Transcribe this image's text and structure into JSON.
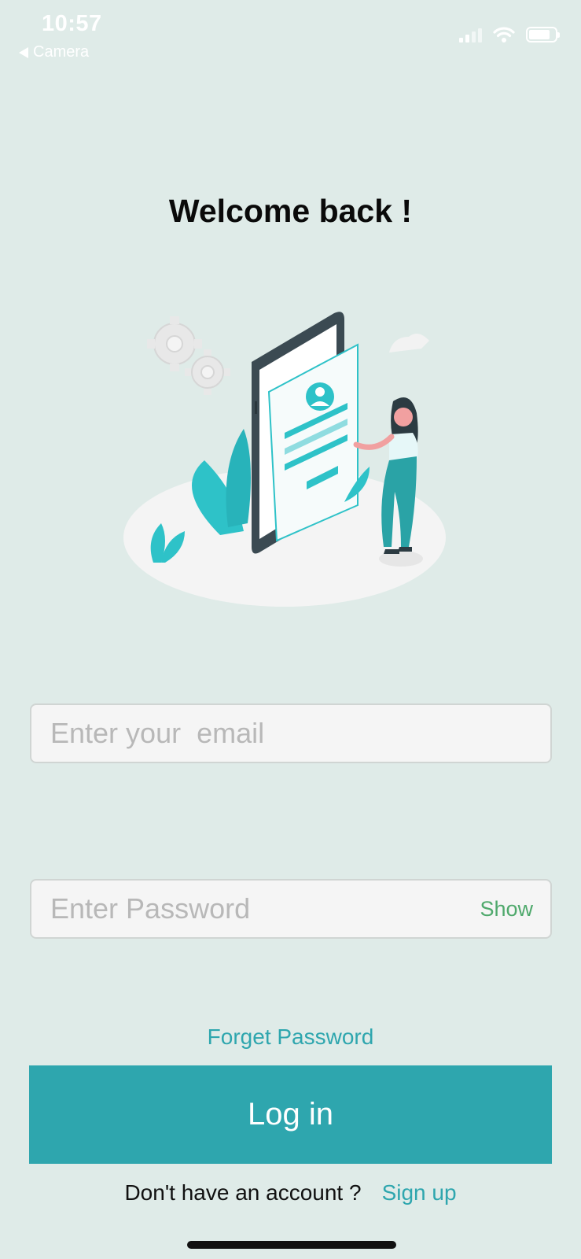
{
  "status_bar": {
    "time": "10:57",
    "back_label": "Camera",
    "icons": [
      "signal-icon",
      "wifi-icon",
      "battery-icon"
    ]
  },
  "title": "Welcome back !",
  "email": {
    "placeholder": "Enter your  email",
    "value": ""
  },
  "password": {
    "placeholder": "Enter Password",
    "value": "",
    "show_label": "Show"
  },
  "forgot_password_label": "Forget Password",
  "login_label": "Log in",
  "signup": {
    "question": "Don't have an account ?",
    "link_label": "Sign up"
  },
  "colors": {
    "background": "#dfebe8",
    "accent": "#2ea6ae",
    "show_green": "#4fa96c"
  }
}
